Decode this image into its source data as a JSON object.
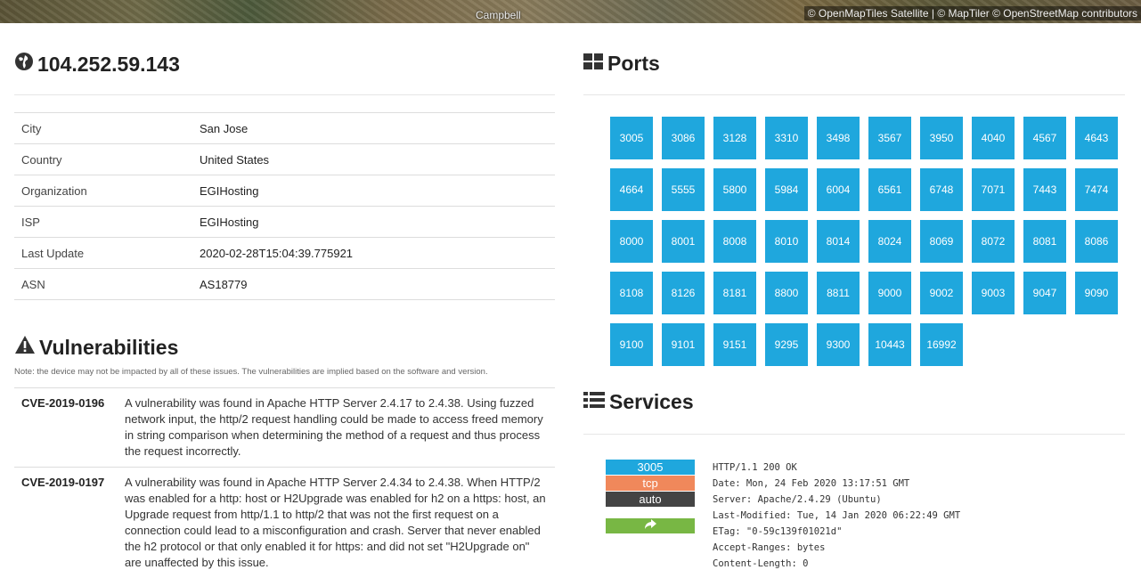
{
  "map": {
    "town_label": "Campbell",
    "attribution": "© OpenMapTiles Satellite | © MapTiler © OpenStreetMap contributors"
  },
  "host": {
    "ip": "104.252.59.143",
    "info": [
      {
        "label": "City",
        "value": "San Jose"
      },
      {
        "label": "Country",
        "value": "United States"
      },
      {
        "label": "Organization",
        "value": "EGIHosting"
      },
      {
        "label": "ISP",
        "value": "EGIHosting"
      },
      {
        "label": "Last Update",
        "value": "2020-02-28T15:04:39.775921"
      },
      {
        "label": "ASN",
        "value": "AS18779"
      }
    ]
  },
  "vulnerabilities": {
    "title": "Vulnerabilities",
    "note": "Note: the device may not be impacted by all of these issues. The vulnerabilities are implied based on the software and version.",
    "items": [
      {
        "id": "CVE-2019-0196",
        "description": "A vulnerability was found in Apache HTTP Server 2.4.17 to 2.4.38. Using fuzzed network input, the http/2 request handling could be made to access freed memory in string comparison when determining the method of a request and thus process the request incorrectly."
      },
      {
        "id": "CVE-2019-0197",
        "description": "A vulnerability was found in Apache HTTP Server 2.4.34 to 2.4.38. When HTTP/2 was enabled for a http: host or H2Upgrade was enabled for h2 on a https: host, an Upgrade request from http/1.1 to http/2 that was not the first request on a connection could lead to a misconfiguration and crash. Server that never enabled the h2 protocol or that only enabled it for https: and did not set \"H2Upgrade on\" are unaffected by this issue."
      }
    ]
  },
  "ports": {
    "title": "Ports",
    "list": [
      "3005",
      "3086",
      "3128",
      "3310",
      "3498",
      "3567",
      "3950",
      "4040",
      "4567",
      "4643",
      "4664",
      "5555",
      "5800",
      "5984",
      "6004",
      "6561",
      "6748",
      "7071",
      "7443",
      "7474",
      "8000",
      "8001",
      "8008",
      "8010",
      "8014",
      "8024",
      "8069",
      "8072",
      "8081",
      "8086",
      "8108",
      "8126",
      "8181",
      "8800",
      "8811",
      "9000",
      "9002",
      "9003",
      "9047",
      "9090",
      "9100",
      "9101",
      "9151",
      "9295",
      "9300",
      "10443",
      "16992"
    ]
  },
  "services": {
    "title": "Services",
    "entries": [
      {
        "port": "3005",
        "protocol": "tcp",
        "module": "auto",
        "banner": [
          "HTTP/1.1 200 OK",
          "Date: Mon, 24 Feb 2020 13:17:51 GMT",
          "Server: Apache/2.4.29 (Ubuntu)",
          "Last-Modified: Tue, 14 Jan 2020 06:22:49 GMT",
          "ETag: \"0-59c139f01021d\"",
          "Accept-Ranges: bytes",
          "Content-Length: 0"
        ]
      }
    ]
  },
  "colors": {
    "port_blue": "#1fa7dd",
    "protocol_orange": "#f0885b",
    "module_dark": "#444444",
    "link_green": "#78b744"
  }
}
